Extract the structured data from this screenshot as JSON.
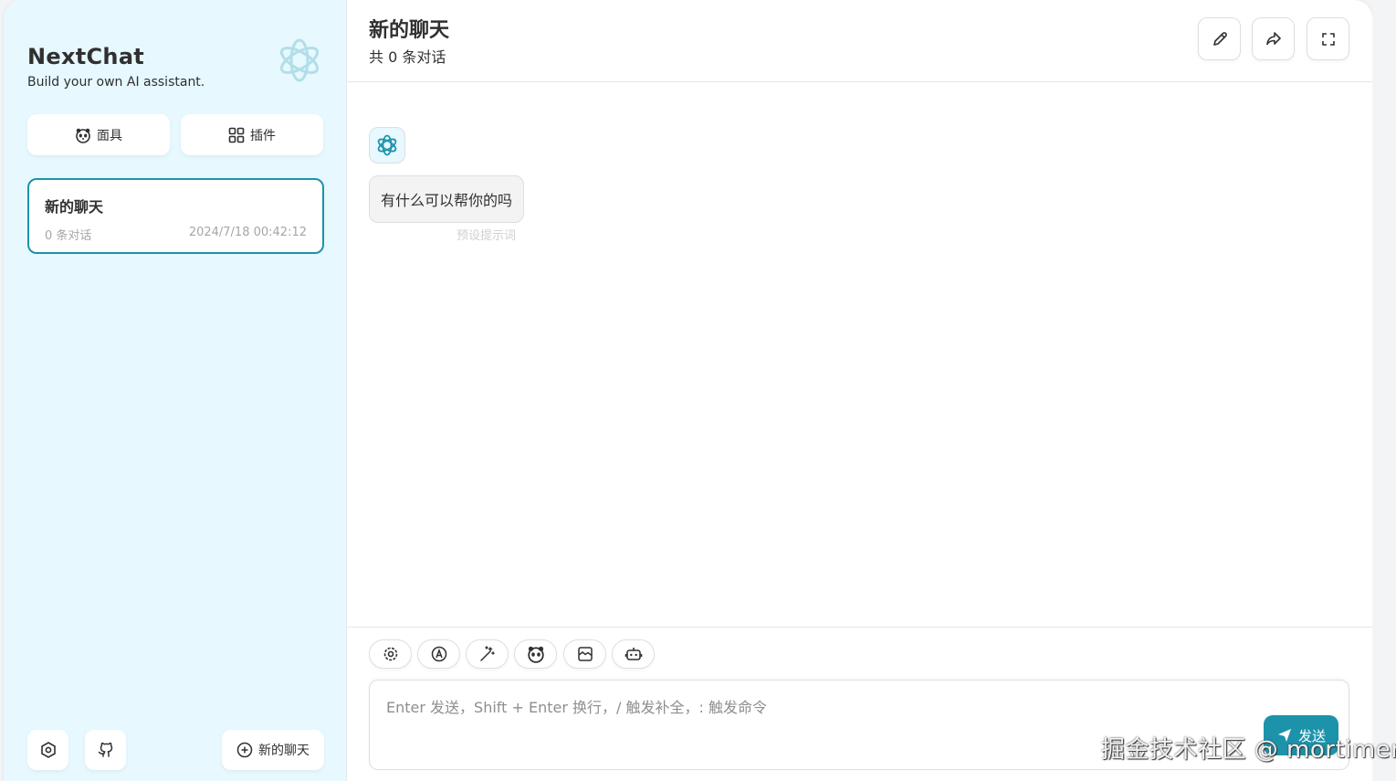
{
  "sidebar": {
    "title": "NextChat",
    "subtitle": "Build your own AI assistant.",
    "masks_label": "面具",
    "plugins_label": "插件",
    "chat_item": {
      "title": "新的聊天",
      "count": "0 条对话",
      "date": "2024/7/18 00:42:12"
    },
    "new_chat_label": "新的聊天"
  },
  "header": {
    "title": "新的聊天",
    "subtitle": "共 0 条对话"
  },
  "message": {
    "text": "有什么可以帮你的吗",
    "hint": "预设提示词"
  },
  "input": {
    "placeholder": "Enter 发送，Shift + Enter 换行，/ 触发补全，: 触发命令",
    "send_label": "发送"
  },
  "watermark": "掘金技术社区 @ mortimer",
  "colors": {
    "accent": "#1d93ab",
    "sidebar_bg": "#e7f8ff"
  }
}
